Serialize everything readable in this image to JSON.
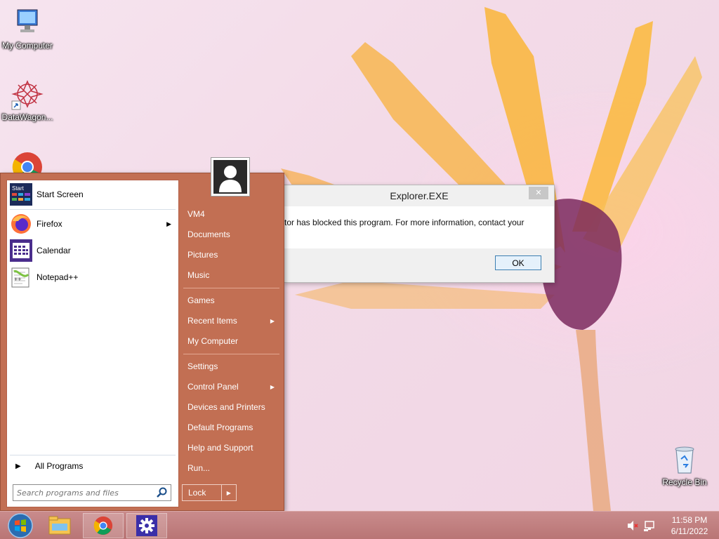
{
  "desktop": {
    "icons": [
      {
        "label": "My Computer",
        "icon": "computer-icon"
      },
      {
        "label": "DataWagon...",
        "icon": "datawagon-icon"
      },
      {
        "label": "",
        "icon": "chrome-icon"
      },
      {
        "label": "Recycle Bin",
        "icon": "recycle-bin-icon"
      }
    ]
  },
  "start_menu": {
    "start_badge": "Start",
    "pinned": [
      {
        "label": "Start Screen",
        "icon": "start-screen-icon"
      },
      {
        "label": "Firefox",
        "icon": "firefox-icon",
        "submenu": true
      },
      {
        "label": "Calendar",
        "icon": "calendar-icon"
      },
      {
        "label": "Notepad++",
        "icon": "notepad-plus-plus-icon"
      }
    ],
    "all_programs": "All Programs",
    "search_placeholder": "Search programs and files",
    "right_items": [
      {
        "label": "VM4"
      },
      {
        "label": "Documents"
      },
      {
        "label": "Pictures"
      },
      {
        "label": "Music"
      },
      {
        "label": "Games"
      },
      {
        "label": "Recent Items",
        "submenu": true
      },
      {
        "label": "My Computer"
      },
      {
        "label": "Settings"
      },
      {
        "label": "Control Panel",
        "submenu": true
      },
      {
        "label": "Devices and Printers"
      },
      {
        "label": "Default Programs"
      },
      {
        "label": "Help and Support"
      },
      {
        "label": "Run..."
      }
    ],
    "lock_label": "Lock"
  },
  "dialog": {
    "title": "Explorer.EXE",
    "message": "tor has blocked this program. For more information, contact your",
    "ok_label": "OK",
    "close_glyph": "✕"
  },
  "taskbar": {
    "buttons": [
      "start-orb-icon",
      "file-explorer-icon",
      "chrome-icon",
      "settings-gear-icon"
    ],
    "clock_time": "11:58 PM",
    "clock_date": "6/11/2022"
  },
  "colors": {
    "start_menu_bg": "#c26f53",
    "taskbar_bg": "#b97575",
    "desktop_bg": "#f3dbe8"
  }
}
